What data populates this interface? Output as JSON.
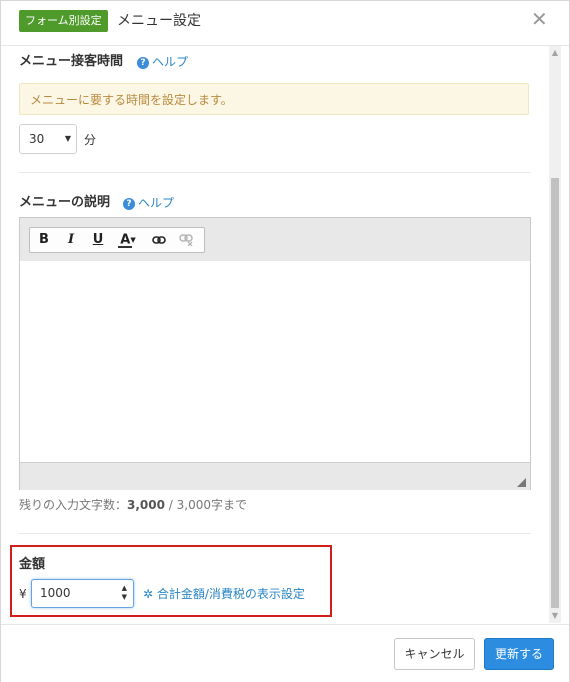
{
  "header": {
    "badge": "フォーム別設定",
    "title": "メニュー設定",
    "close_glyph": "✕"
  },
  "duration": {
    "title": "メニュー接客時間",
    "help_label": "ヘルプ",
    "notice": "メニューに要する時間を設定します。",
    "selected_value": "30",
    "unit": "分"
  },
  "description": {
    "title": "メニューの説明",
    "help_label": "ヘルプ",
    "toolbar": {
      "bold": "B",
      "italic": "I",
      "underline": "U",
      "text_color": "A"
    },
    "counter_prefix": "残りの入力文字数：",
    "counter_remaining": "3,000",
    "counter_sep": " / ",
    "counter_suffix": "3,000字まで"
  },
  "price": {
    "title": "金額",
    "currency": "¥",
    "value": "1000",
    "tax_link": "合計金額/消費税の表示設定"
  },
  "footer": {
    "cancel_label": "キャンセル",
    "update_label": "更新する"
  },
  "colors": {
    "badge": "#4e9a2a",
    "link": "#2a86c4",
    "primary_button": "#2c8ce0",
    "highlight_border": "#d21d1d",
    "notice_bg": "#fcf6e4"
  }
}
